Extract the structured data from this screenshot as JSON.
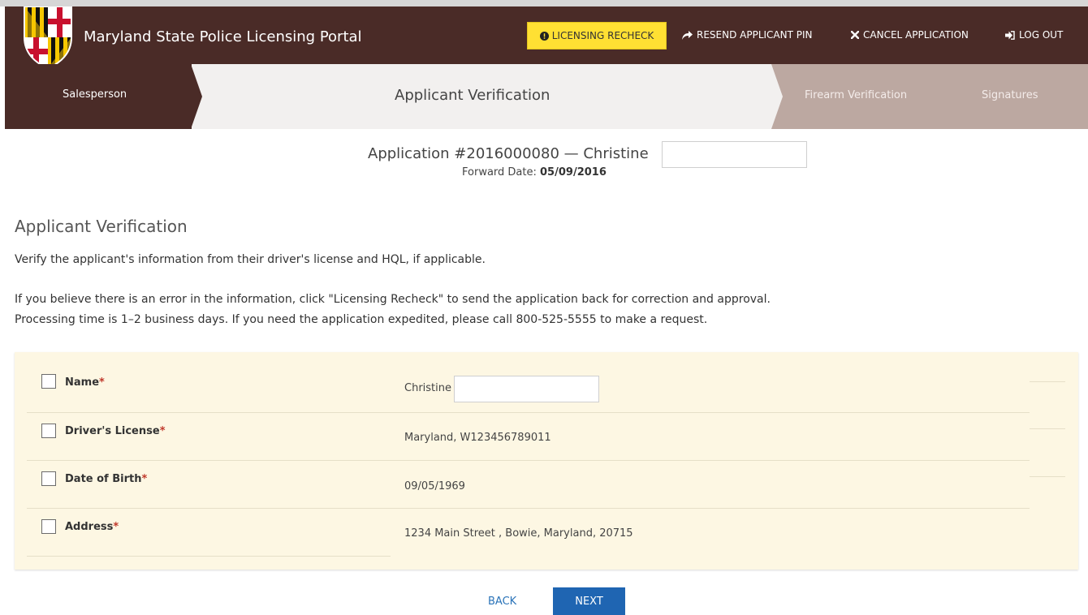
{
  "header": {
    "brand": "Maryland State Police Licensing Portal",
    "nav": {
      "licensing_recheck": "LICENSING RECHECK",
      "resend_pin": "RESEND APPLICANT PIN",
      "cancel_application": "CANCEL APPLICATION",
      "log_out": "LOG OUT"
    }
  },
  "steps": {
    "salesperson": "Salesperson",
    "current": "Applicant Verification",
    "firearm": "Firearm Verification",
    "signatures": "Signatures"
  },
  "application": {
    "title": "Application #2016000080 — Christine",
    "forward_label": "Forward Date:",
    "forward_date": "05/09/2016"
  },
  "section": {
    "title": "Applicant Verification",
    "instructions": "Verify the applicant's information from their driver's license and HQL, if applicable.",
    "error_note": "If you believe there is an error in the information, click \"Licensing Recheck\" to send the application back for correction and approval.",
    "processing_note": "Processing time is 1–2 business days. If you need the application expedited, please call 800-525-5555 to make a request."
  },
  "fields": [
    {
      "label": "Name",
      "value": "Christine"
    },
    {
      "label": "Driver's License",
      "value": "Maryland, W123456789011"
    },
    {
      "label": "Date of Birth",
      "value": "09/05/1969"
    },
    {
      "label": "Address",
      "value": "1234 Main Street , Bowie, Maryland, 20715"
    }
  ],
  "required_marker": "*",
  "buttons": {
    "back": "BACK",
    "next": "NEXT"
  },
  "colors": {
    "header_bg": "#4a2b27",
    "recheck_bg": "#ffe033",
    "panel_bg": "#fdf7e3",
    "next_bg": "#1f65b2",
    "required": "#c0392b"
  }
}
